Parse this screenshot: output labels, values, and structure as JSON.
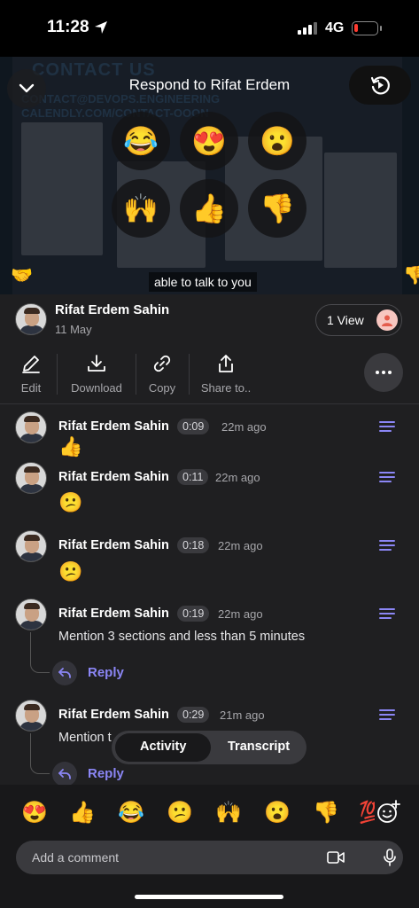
{
  "status_bar": {
    "time": "11:28",
    "network": "4G"
  },
  "video": {
    "title": "Respond to Rifat Erdem",
    "slide_heading": "CONTACT US",
    "slide_line_1": "CONTACT@DEVOPS.ENGINEERING",
    "slide_line_2": "CALENDLY.COM/CONTACT-OOON",
    "caption": "able to talk to you",
    "reactions": [
      "😂",
      "😍",
      "😮",
      "🙌",
      "👍",
      "👎"
    ],
    "floating_emojis": [
      "🤝",
      "👎"
    ]
  },
  "owner": {
    "name": "Rifat Erdem Sahin",
    "date": "11 May",
    "views": "1 View"
  },
  "actions": {
    "edit": "Edit",
    "download": "Download",
    "copy": "Copy",
    "share": "Share to.."
  },
  "comments": [
    {
      "name": "Rifat Erdem Sahin",
      "stamp": "0:09",
      "ago": "22m ago",
      "emoji": "👍"
    },
    {
      "name": "Rifat Erdem Sahin",
      "stamp": "0:11",
      "ago": "22m ago",
      "emoji": "😕"
    },
    {
      "name": "Rifat Erdem Sahin",
      "stamp": "0:18",
      "ago": "22m ago",
      "emoji": "😕"
    },
    {
      "name": "Rifat Erdem Sahin",
      "stamp": "0:19",
      "ago": "22m ago",
      "text": "Mention 3 sections and less than 5 minutes",
      "reply": "Reply"
    },
    {
      "name": "Rifat Erdem Sahin",
      "stamp": "0:29",
      "ago": "21m ago",
      "text": "Mention t",
      "reply": "Reply"
    }
  ],
  "toggle": {
    "activity": "Activity",
    "transcript": "Transcript"
  },
  "bottom": {
    "emojis": [
      "😍",
      "👍",
      "😂",
      "😕",
      "🙌",
      "😮",
      "👎",
      "💯"
    ],
    "comment_placeholder": "Add a comment"
  },
  "colors": {
    "accent": "#8b86f5",
    "background": "#1f1f21",
    "pill": "#3a3a3e"
  }
}
